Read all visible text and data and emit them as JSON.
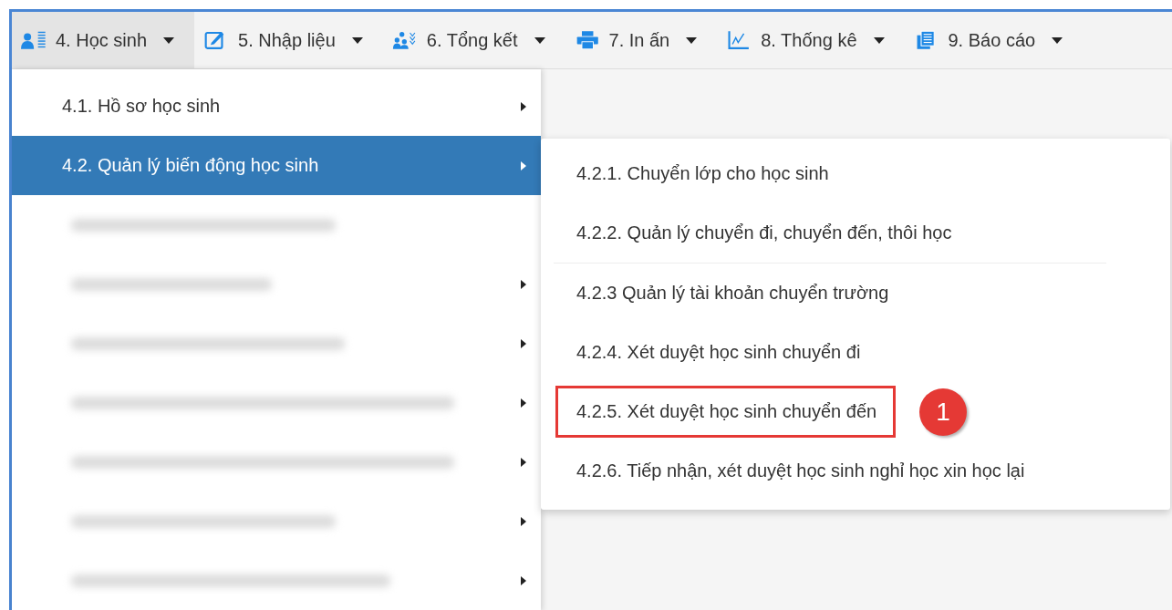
{
  "menubar": [
    {
      "label": "4. Học sinh",
      "selected": true
    },
    {
      "label": "5. Nhập liệu",
      "selected": false
    },
    {
      "label": "6. Tổng kết",
      "selected": false
    },
    {
      "label": "7. In ấn",
      "selected": false
    },
    {
      "label": "8. Thống kê",
      "selected": false
    },
    {
      "label": "9. Báo cáo",
      "selected": false
    }
  ],
  "menu": {
    "items": [
      {
        "kind": "text",
        "label": "4.1. Hồ sơ học sinh",
        "selected": false,
        "has_submenu": true
      },
      {
        "kind": "text",
        "label": "4.2. Quản lý biến động học sinh",
        "selected": true,
        "has_submenu": true
      },
      {
        "kind": "blurred",
        "has_submenu": false
      },
      {
        "kind": "blurred",
        "has_submenu": true
      },
      {
        "kind": "blurred",
        "has_submenu": true
      },
      {
        "kind": "blurred",
        "has_submenu": true
      },
      {
        "kind": "blurred",
        "has_submenu": true
      },
      {
        "kind": "blurred",
        "has_submenu": true
      },
      {
        "kind": "blurred",
        "has_submenu": true
      }
    ]
  },
  "submenu": {
    "items": [
      {
        "label": "4.2.1. Chuyển lớp cho học sinh",
        "highlighted": false
      },
      {
        "label": "4.2.2. Quản lý chuyển đi, chuyển đến, thôi học",
        "highlighted": false
      },
      {
        "label": "4.2.3 Quản lý tài khoản chuyển trường",
        "highlighted": false
      },
      {
        "label": "4.2.4. Xét duyệt học sinh chuyển đi",
        "highlighted": false
      },
      {
        "label": "4.2.5. Xét duyệt học sinh chuyển đến",
        "highlighted": true,
        "badge": "1"
      },
      {
        "label": "4.2.6. Tiếp nhận, xét duyệt học sinh nghỉ học xin học lại",
        "highlighted": false
      }
    ]
  }
}
